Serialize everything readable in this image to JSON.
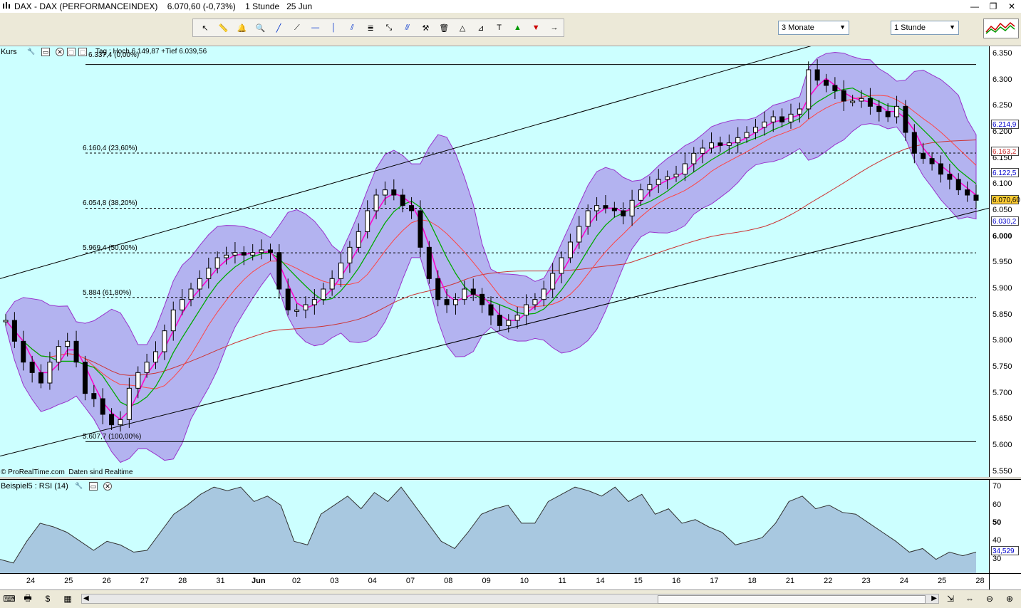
{
  "window": {
    "title": "DAX - DAX (PERFORMANCEINDEX)    6.070,60 (-0,73%)    1 Stunde   25 Jun",
    "buttons": [
      "—",
      "❐",
      "✕"
    ]
  },
  "toolbar": {
    "period_select": "3 Monate",
    "interval_select": "1 Stunde",
    "tools": [
      "cursor-icon",
      "ruler-icon",
      "alarm-icon",
      "zoom-icon",
      "line-icon",
      "segment-icon",
      "horizontal-line-icon",
      "vertical-line-icon",
      "channel-icon",
      "fibonacci-icon",
      "fan-icon",
      "parallel-icon",
      "tools-icon",
      "trash-icon",
      "triangle-icon",
      "fib-fan-icon",
      "text-icon",
      "buy-arrow-icon",
      "sell-arrow-icon",
      "next-arrow-icon"
    ]
  },
  "price_panel": {
    "title": "Kurs",
    "header_info": "Tag : Hoch 6.149,87 +Tief 6.039,56",
    "fib_top_label": "6.337,4 (0,00%)",
    "fib_levels": [
      {
        "label": "6.160,4 (23,60%)",
        "value": 6160.4
      },
      {
        "label": "6.054,8 (38,20%)",
        "value": 6054.8
      },
      {
        "label": "5.969,4 (50,00%)",
        "value": 5969.4
      },
      {
        "label": "5.884 (61,80%)",
        "value": 5884
      },
      {
        "label": "5.607,7 (100,00%)",
        "value": 5607.7
      }
    ],
    "fib_top_value": 6330,
    "credit": "© ProRealTime.com  Daten sind Realtime",
    "y_ticks": [
      "6.350",
      "6.300",
      "6.250",
      "6.200",
      "6.150",
      "6.100",
      "6.050",
      "6.000",
      "5.950",
      "5.900",
      "5.850",
      "5.800",
      "5.750",
      "5.700",
      "5.650",
      "5.600",
      "5.550"
    ],
    "y_tick_values": [
      6350,
      6300,
      6250,
      6200,
      6150,
      6100,
      6050,
      6000,
      5950,
      5900,
      5850,
      5800,
      5750,
      5700,
      5650,
      5600,
      5550
    ],
    "price_tags": [
      {
        "text": "6.214,9",
        "value": 6214.9,
        "color": "#0000cc",
        "bg": "#ffffff"
      },
      {
        "text": "6.163,2",
        "value": 6163.2,
        "color": "#cc3333",
        "bg": "#ffffff"
      },
      {
        "text": "6.122,5",
        "value": 6122.5,
        "color": "#0000cc",
        "bg": "#ffffff"
      },
      {
        "text": "6.070,60",
        "value": 6070.6,
        "color": "#000000",
        "bg": "#ffcc33"
      },
      {
        "text": "6.030,2",
        "value": 6030.2,
        "color": "#0000cc",
        "bg": "#ffffff"
      }
    ],
    "colors": {
      "background": "#ccffff",
      "bollinger_fill": "#b3b3f0",
      "bollinger_line": "#9933cc",
      "ema_fast": "#ff00cc",
      "ema_mid": "#00aa00",
      "ma_slow": "#ff4444",
      "ma_long": "#cc3333"
    }
  },
  "rsi_panel": {
    "title": "Beispiel5 : RSI (14)",
    "y_ticks": [
      "70",
      "60",
      "50",
      "40",
      "30"
    ],
    "y_tick_values": [
      70,
      60,
      50,
      40,
      30
    ],
    "current_tag": "34,529",
    "colors": {
      "fill": "#a8c8e0",
      "line": "#333333"
    }
  },
  "x_axis": {
    "labels": [
      "24",
      "25",
      "26",
      "27",
      "28",
      "31",
      "Jun",
      "02",
      "03",
      "04",
      "07",
      "08",
      "09",
      "10",
      "11",
      "14",
      "15",
      "16",
      "17",
      "18",
      "21",
      "22",
      "23",
      "24",
      "25",
      "28"
    ]
  },
  "chart_data": {
    "type": "candlestick",
    "approximate_close_series": [
      5840,
      5800,
      5760,
      5740,
      5720,
      5760,
      5790,
      5800,
      5760,
      5700,
      5690,
      5660,
      5640,
      5650,
      5710,
      5740,
      5760,
      5780,
      5820,
      5860,
      5880,
      5900,
      5920,
      5940,
      5960,
      5965,
      5970,
      5965,
      5970,
      5975,
      5970,
      5900,
      5860,
      5860,
      5870,
      5880,
      5900,
      5920,
      5950,
      5980,
      6010,
      6050,
      6080,
      6090,
      6080,
      6060,
      6050,
      5980,
      5920,
      5880,
      5870,
      5880,
      5900,
      5890,
      5870,
      5850,
      5830,
      5840,
      5850,
      5870,
      5880,
      5900,
      5930,
      5960,
      5990,
      6020,
      6050,
      6060,
      6055,
      6050,
      6040,
      6070,
      6090,
      6100,
      6110,
      6115,
      6120,
      6140,
      6160,
      6170,
      6180,
      6175,
      6180,
      6190,
      6200,
      6210,
      6220,
      6230,
      6220,
      6235,
      6245,
      6320,
      6300,
      6290,
      6280,
      6260,
      6260,
      6265,
      6250,
      6240,
      6230,
      6250,
      6200,
      6160,
      6150,
      6140,
      6120,
      6110,
      6090,
      6080,
      6070
    ],
    "approximate_rsi_series": [
      30,
      28,
      40,
      50,
      48,
      45,
      40,
      35,
      40,
      38,
      34,
      35,
      45,
      55,
      60,
      66,
      70,
      68,
      70,
      62,
      65,
      60,
      40,
      38,
      55,
      60,
      65,
      58,
      67,
      62,
      70,
      60,
      50,
      40,
      36,
      45,
      55,
      58,
      60,
      50,
      50,
      62,
      66,
      70,
      68,
      65,
      70,
      62,
      66,
      55,
      58,
      50,
      52,
      48,
      45,
      38,
      40,
      42,
      50,
      62,
      65,
      58,
      60,
      56,
      55,
      50,
      45,
      40,
      34,
      36,
      30,
      34,
      32,
      34
    ]
  }
}
